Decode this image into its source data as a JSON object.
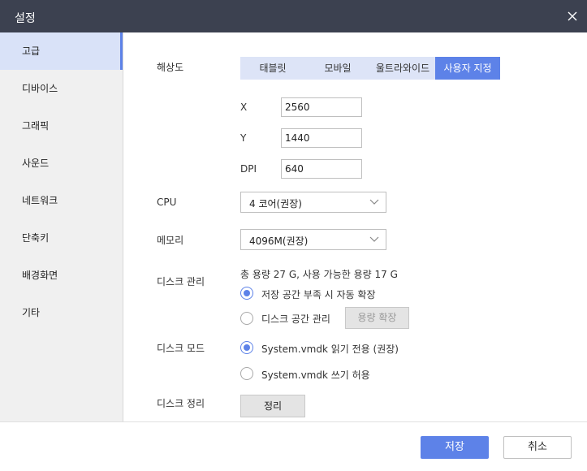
{
  "window": {
    "title": "설정"
  },
  "sidebar": {
    "items": [
      {
        "label": "고급",
        "active": true
      },
      {
        "label": "디바이스"
      },
      {
        "label": "그래픽"
      },
      {
        "label": "사운드"
      },
      {
        "label": "네트워크"
      },
      {
        "label": "단축키"
      },
      {
        "label": "배경화면"
      },
      {
        "label": "기타"
      }
    ]
  },
  "resolution": {
    "label": "해상도",
    "tabs": [
      "태블릿",
      "모바일",
      "울트라와이드",
      "사용자 지정"
    ],
    "selected_tab": "사용자 지정",
    "x_label": "X",
    "x_value": "2560",
    "y_label": "Y",
    "y_value": "1440",
    "dpi_label": "DPI",
    "dpi_value": "640"
  },
  "cpu": {
    "label": "CPU",
    "value": "4 코어(권장)"
  },
  "memory": {
    "label": "메모리",
    "value": "4096M(권장)"
  },
  "disk_management": {
    "label": "디스크 관리",
    "summary": "총 용량 27 G,  사용 가능한 용량 17 G",
    "option_auto": "저장 공간 부족 시 자동 확장",
    "option_manual": "디스크 공간 관리",
    "expand_button": "용량 확장"
  },
  "disk_mode": {
    "label": "디스크 모드",
    "option_readonly": "System.vmdk 읽기 전용 (권장)",
    "option_write": "System.vmdk 쓰기 허용"
  },
  "disk_cleanup": {
    "label": "디스크 정리",
    "button": "정리"
  },
  "footer": {
    "save": "저장",
    "cancel": "취소"
  },
  "colors": {
    "accent": "#5d82e8",
    "titlebar": "#3c4150",
    "sidebar_active": "#d9e2f8",
    "tab_bg": "#dde4f7"
  }
}
